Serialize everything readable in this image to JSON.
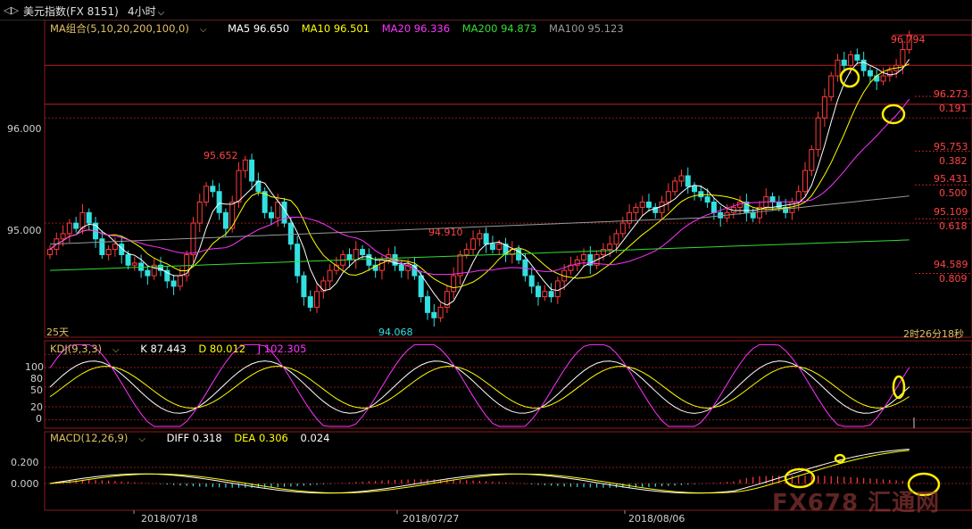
{
  "topbar": {
    "back_icon": "back-forward-icon",
    "symbol": "美元指数(FX 8151)",
    "period": "4小时"
  },
  "main_panel": {
    "ma_group_label": "MA组合(5,10,20,200,100,0)",
    "ma5": "MA5 96.650",
    "ma10": "MA10 96.501",
    "ma20": "MA20 96.336",
    "ma200": "MA200 94.873",
    "ma100": "MA100 95.123",
    "y_ticks": [
      "96.000",
      "95.000"
    ],
    "annotations": {
      "high_label": "96.794",
      "peak1": "95.652",
      "peak2": "94.910",
      "low_label": "94.068",
      "days": "25天",
      "countdown": "2时26分18秒"
    },
    "fib_levels": [
      {
        "price": "96.273",
        "ratio": "0.191"
      },
      {
        "price": "95.753",
        "ratio": "0.382"
      },
      {
        "price": "95.431",
        "ratio": "0.500"
      },
      {
        "price": "95.109",
        "ratio": "0.618"
      },
      {
        "price": "94.589",
        "ratio": "0.809"
      }
    ]
  },
  "kdj_panel": {
    "label": "KDJ(9,3,3)",
    "k": "K 87.443",
    "d": "D 80.012",
    "j": "J 102.305",
    "y_ticks": [
      "100",
      "80",
      "50",
      "20",
      "0"
    ]
  },
  "macd_panel": {
    "label": "MACD(12,26,9)",
    "diff": "DIFF 0.318",
    "dea": "DEA 0.306",
    "macd": "0.024",
    "y_ticks": [
      "0.200",
      "0.000"
    ]
  },
  "x_axis": {
    "dates": [
      "2018/07/18",
      "2018/07/27",
      "2018/08/06"
    ]
  },
  "watermark": "FX678 汇通网",
  "colors": {
    "up": "#ff3b3b",
    "down": "#33e0e0",
    "ma5": "#ffffff",
    "ma10": "#ffff00",
    "ma20": "#ff33ff",
    "ma200": "#33dd33",
    "ma100": "#999999",
    "grid": "#8b1a1a",
    "highlight": "#ffee00"
  },
  "chart_data": {
    "type": "candlestick",
    "title": "美元指数(FX 8151) 4小时",
    "ylim": [
      94.0,
      96.85
    ],
    "y_ticks": [
      96.0,
      95.0
    ],
    "closes": [
      94.75,
      94.85,
      94.9,
      95.0,
      94.95,
      95.1,
      95.0,
      94.85,
      94.7,
      94.75,
      94.8,
      94.7,
      94.6,
      94.62,
      94.55,
      94.5,
      94.6,
      94.55,
      94.45,
      94.4,
      94.5,
      94.7,
      95.0,
      95.2,
      95.35,
      95.3,
      95.1,
      94.95,
      95.2,
      95.5,
      95.6,
      95.4,
      95.3,
      95.1,
      95.05,
      95.2,
      95.0,
      94.8,
      94.5,
      94.3,
      94.2,
      94.35,
      94.45,
      94.55,
      94.6,
      94.7,
      94.65,
      94.75,
      94.7,
      94.6,
      94.55,
      94.65,
      94.7,
      94.6,
      94.55,
      94.6,
      94.5,
      94.3,
      94.15,
      94.1,
      94.2,
      94.35,
      94.5,
      94.7,
      94.75,
      94.85,
      94.9,
      94.8,
      94.75,
      94.8,
      94.7,
      94.75,
      94.65,
      94.5,
      94.4,
      94.3,
      94.35,
      94.3,
      94.45,
      94.55,
      94.6,
      94.65,
      94.7,
      94.6,
      94.7,
      94.75,
      94.8,
      94.9,
      95.0,
      95.1,
      95.15,
      95.2,
      95.15,
      95.1,
      95.2,
      95.3,
      95.4,
      95.45,
      95.35,
      95.3,
      95.25,
      95.2,
      95.1,
      95.05,
      95.1,
      95.15,
      95.2,
      95.1,
      95.05,
      95.15,
      95.25,
      95.2,
      95.15,
      95.1,
      95.2,
      95.3,
      95.5,
      95.7,
      96.0,
      96.2,
      96.4,
      96.55,
      96.5,
      96.6,
      96.55,
      96.45,
      96.4,
      96.35,
      96.4,
      96.45,
      96.5,
      96.65,
      96.79
    ]
  }
}
